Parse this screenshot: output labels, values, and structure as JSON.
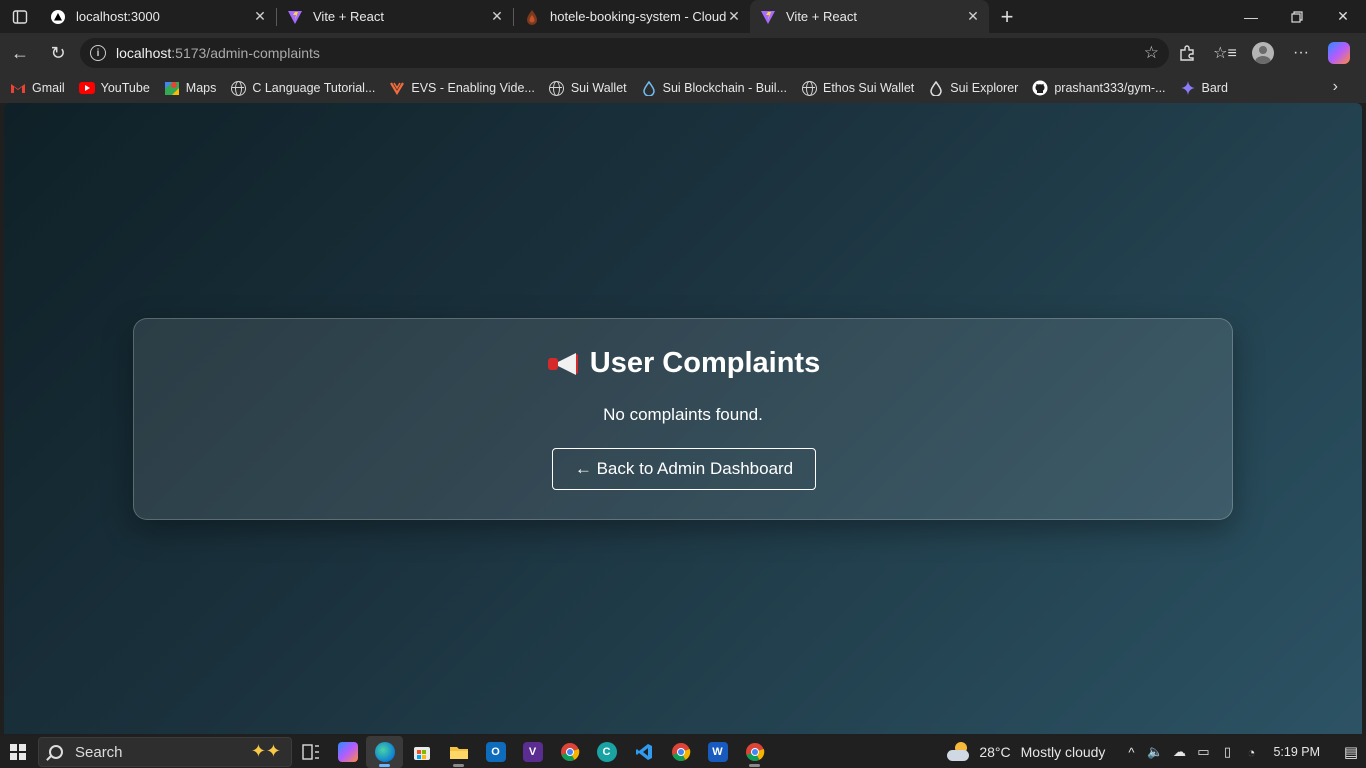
{
  "browser": {
    "tabs": [
      {
        "title": "localhost:3000",
        "favicon": "triangle-icon",
        "active": false
      },
      {
        "title": "Vite + React",
        "favicon": "vite-icon",
        "active": false
      },
      {
        "title": "hotele-booking-system - Cloud Fir",
        "favicon": "firebase-icon",
        "active": false
      },
      {
        "title": "Vite + React",
        "favicon": "vite-icon",
        "active": true
      }
    ],
    "url_host": "localhost",
    "url_path": ":5173/admin-complaints",
    "bookmarks": [
      {
        "label": "Gmail",
        "icon": "gmail-icon"
      },
      {
        "label": "YouTube",
        "icon": "youtube-icon"
      },
      {
        "label": "Maps",
        "icon": "maps-icon"
      },
      {
        "label": "C Language Tutorial...",
        "icon": "globe-icon"
      },
      {
        "label": "EVS - Enabling Vide...",
        "icon": "evs-icon"
      },
      {
        "label": "Sui Wallet",
        "icon": "globe-icon"
      },
      {
        "label": "Sui Blockchain - Buil...",
        "icon": "sui-drop-icon"
      },
      {
        "label": "Ethos Sui Wallet",
        "icon": "globe-icon"
      },
      {
        "label": "Sui Explorer",
        "icon": "sui-drop-icon"
      },
      {
        "label": "prashant333/gym-...",
        "icon": "github-icon"
      },
      {
        "label": "Bard",
        "icon": "bard-sparkle-icon"
      }
    ]
  },
  "page": {
    "title": "User Complaints",
    "empty_message": "No complaints found.",
    "back_button_label": "← Back to Admin Dashboard"
  },
  "taskbar": {
    "search_placeholder": "Search",
    "weather_temp": "28°C",
    "weather_desc": "Mostly cloudy",
    "time": "5:19 PM"
  },
  "colors": {
    "bg_gradient_start": "#0f2027",
    "bg_gradient_end": "#2c5364",
    "accent_red": "#d62a2a"
  }
}
